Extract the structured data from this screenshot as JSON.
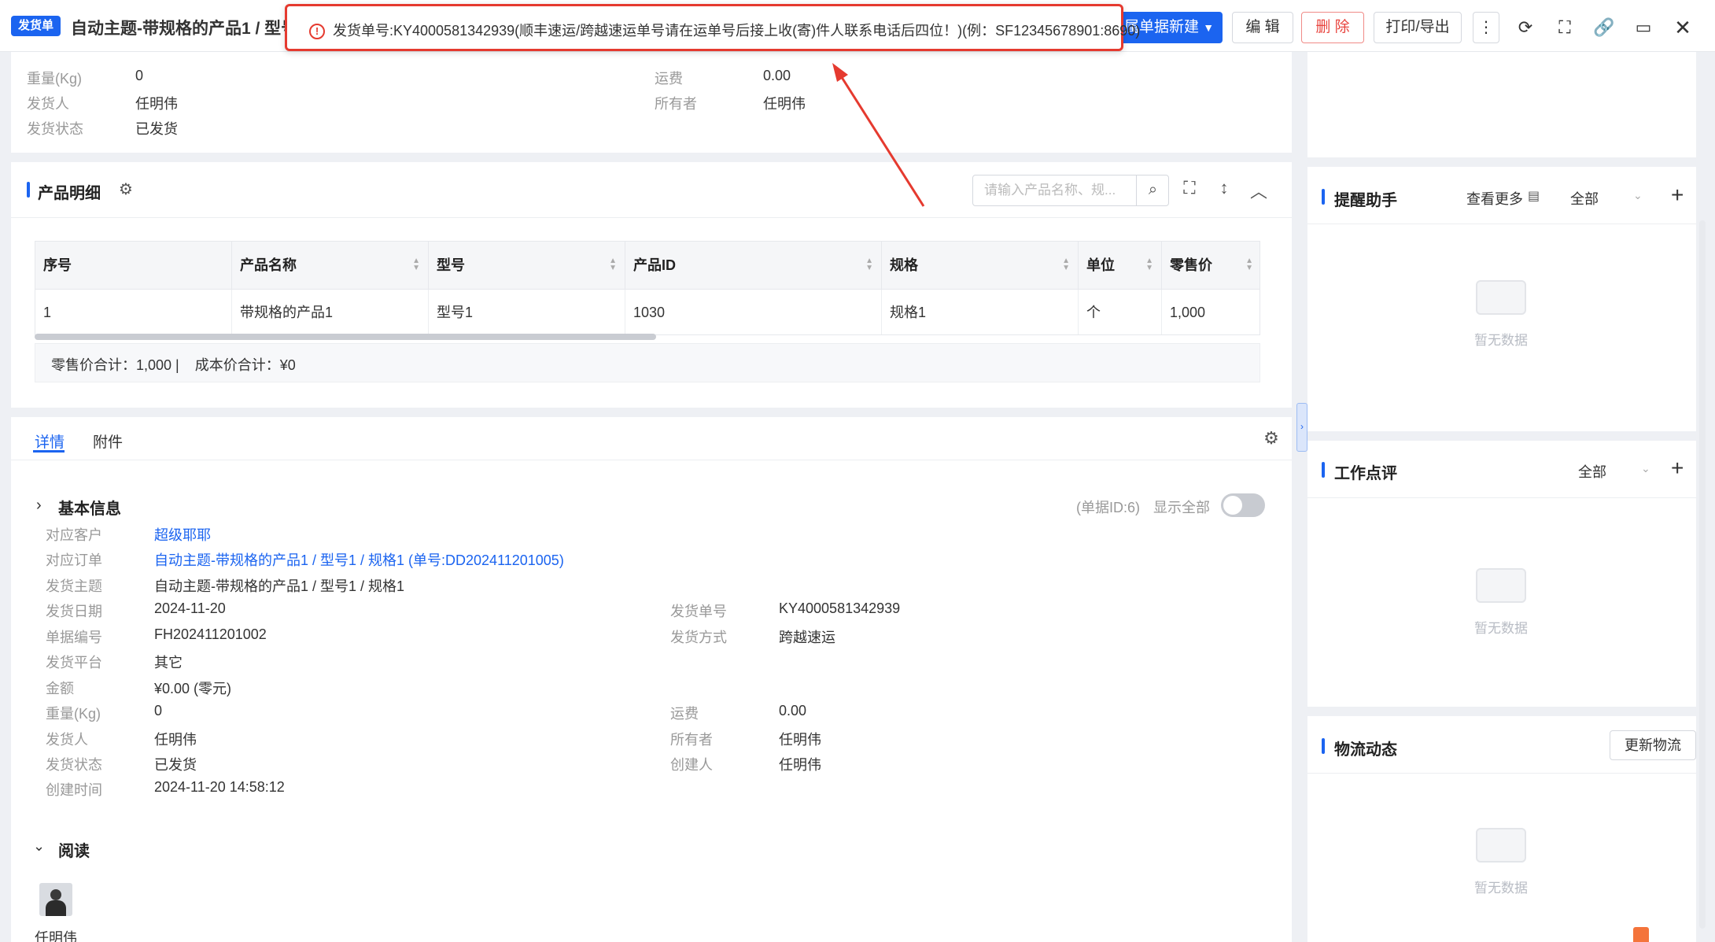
{
  "header": {
    "badge": "发货单",
    "title": "自动主题-带规格的产品1 / 型号1",
    "new_from_doc": "属单据新建",
    "edit": "编 辑",
    "delete": "删 除",
    "print": "打印/导出"
  },
  "toast": {
    "message": "发货单号:KY4000581342939(顺丰速运/跨越速运单号请在运单号后接上收(寄)件人联系电话后四位！)(例：SF12345678901:8690)"
  },
  "top_info": {
    "weight_label": "重量(Kg)",
    "weight": "0",
    "freight_label": "运费",
    "freight": "0.00",
    "shipper_label": "发货人",
    "shipper": "任明伟",
    "owner_label": "所有者",
    "owner": "任明伟",
    "status_label": "发货状态",
    "status": "已发货"
  },
  "products": {
    "title": "产品明细",
    "search_placeholder": "请输入产品名称、规...",
    "columns": [
      "序号",
      "产品名称",
      "型号",
      "产品ID",
      "规格",
      "单位",
      "零售价"
    ],
    "rows": [
      [
        "1",
        "带规格的产品1",
        "型号1",
        "1030",
        "规格1",
        "个",
        "1,000"
      ]
    ],
    "summary": "零售价合计：1,000 |    成本价合计：¥0"
  },
  "tabs": {
    "detail": "详情",
    "attachment": "附件"
  },
  "basic": {
    "title": "基本信息",
    "doc_id": "(单据ID:6)",
    "show_all": "显示全部",
    "customer_label": "对应客户",
    "customer": "超级耶耶",
    "order_label": "对应订单",
    "order": "自动主题-带规格的产品1 / 型号1 / 规格1 (单号:DD202411201005)",
    "subject_label": "发货主题",
    "subject": "自动主题-带规格的产品1 / 型号1 / 规格1",
    "date_label": "发货日期",
    "date": "2024-11-20",
    "ship_no_label": "发货单号",
    "ship_no": "KY4000581342939",
    "doc_no_label": "单据编号",
    "doc_no": "FH202411201002",
    "method_label": "发货方式",
    "method": "跨越速运",
    "platform_label": "发货平台",
    "platform": "其它",
    "amount_label": "金额",
    "amount": "¥0.00 (零元)",
    "weight_label": "重量(Kg)",
    "weight": "0",
    "freight_label": "运费",
    "freight": "0.00",
    "shipper_label": "发货人",
    "shipper": "任明伟",
    "owner_label": "所有者",
    "owner": "任明伟",
    "status_label": "发货状态",
    "status": "已发货",
    "creator_label": "创建人",
    "creator": "任明伟",
    "created_label": "创建时间",
    "created": "2024-11-20 14:58:12"
  },
  "reading": {
    "title": "阅读",
    "user": "任明伟"
  },
  "sidebar": {
    "reminder": {
      "title": "提醒助手",
      "more": "查看更多",
      "filter": "全部",
      "empty": "暂无数据"
    },
    "review": {
      "title": "工作点评",
      "filter": "全部",
      "empty": "暂无数据"
    },
    "logistics": {
      "title": "物流动态",
      "update": "更新物流",
      "empty": "暂无数据"
    }
  },
  "colors": {
    "accent": "#1b64f0",
    "danger": "#e53a2f"
  },
  "icons": [
    "settings-icon",
    "search-icon",
    "fullscreen-icon",
    "expand-rows-icon",
    "collapse-icon",
    "refresh-icon",
    "link-icon",
    "monitor-icon",
    "close-icon",
    "more-icon",
    "plus-icon",
    "chevron-down-icon",
    "error-icon"
  ]
}
